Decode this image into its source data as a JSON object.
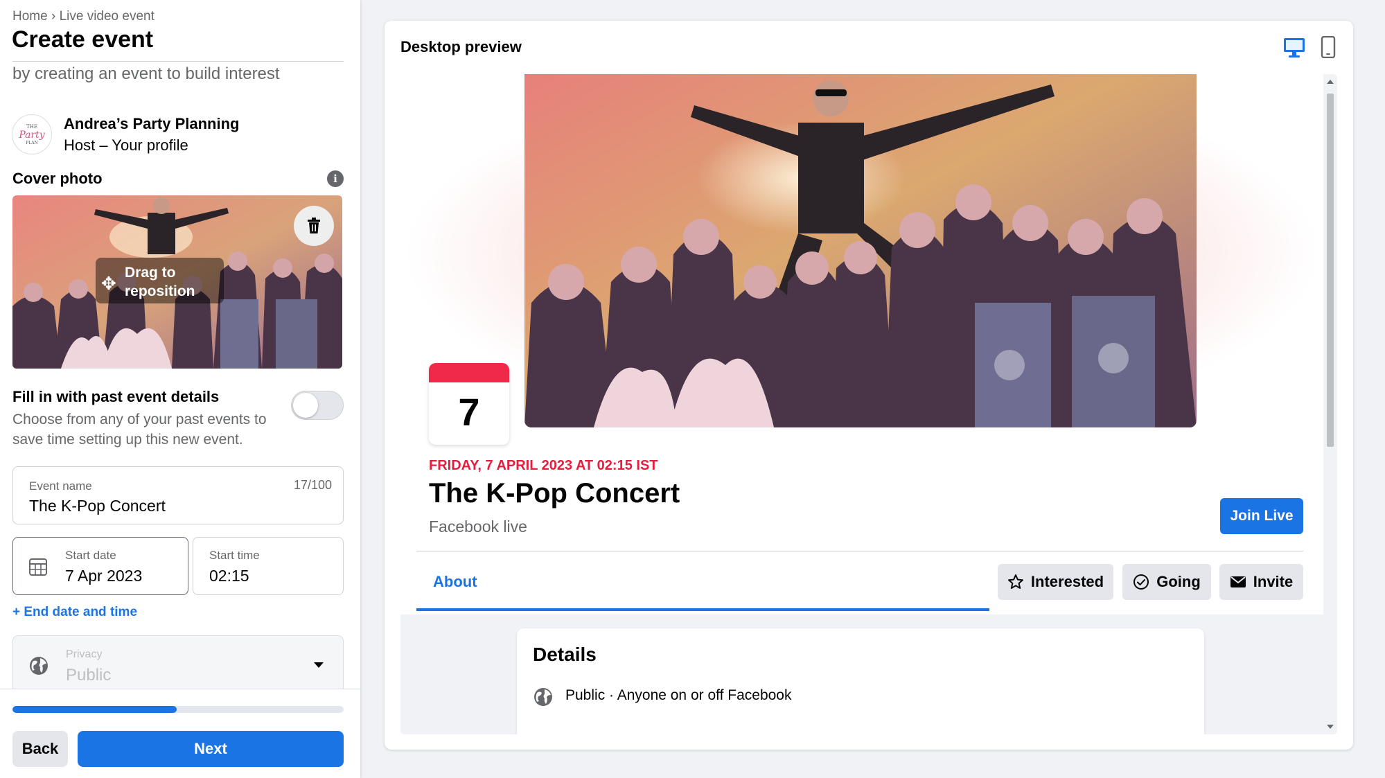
{
  "breadcrumb": "Home › Live video event",
  "page_title": "Create event",
  "intro_text": "by creating an event to build interest",
  "host": {
    "avatar_line1": "THE",
    "avatar_line2": "Party",
    "avatar_line3": "PLAN",
    "name": "Andrea’s Party Planning",
    "role": "Host – Your profile"
  },
  "cover_photo": {
    "label": "Cover photo",
    "drag_hint_line1": "Drag to",
    "drag_hint_line2": "reposition"
  },
  "fill_past": {
    "title": "Fill in with past event details",
    "description": "Choose from any of your past events to save time setting up this new event.",
    "enabled": false
  },
  "form": {
    "event_name_label": "Event name",
    "event_name_value": "The K-Pop Concert",
    "event_name_count": "17/100",
    "start_date_label": "Start date",
    "start_date_value": "7 Apr 2023",
    "start_time_label": "Start time",
    "start_time_value": "02:15",
    "end_date_link": "+ End date and time",
    "privacy_label": "Privacy",
    "privacy_value": "Public"
  },
  "progress_fraction": 0.495,
  "buttons": {
    "back": "Back",
    "next": "Next"
  },
  "preview": {
    "title": "Desktop preview",
    "date_number": "7",
    "event_datetime": "FRIDAY, 7 APRIL 2023 AT 02:15 IST",
    "event_title": "The K-Pop Concert",
    "event_subtitle": "Facebook live",
    "join_button": "Join Live",
    "about_tab": "About",
    "interested_button": "Interested",
    "going_button": "Going",
    "invite_button": "Invite",
    "details_title": "Details",
    "details_privacy": "Public · Anyone on or off Facebook"
  },
  "colors": {
    "accent": "#1b74e4",
    "date_red": "#e41e3f",
    "badge_red": "#f02849"
  }
}
